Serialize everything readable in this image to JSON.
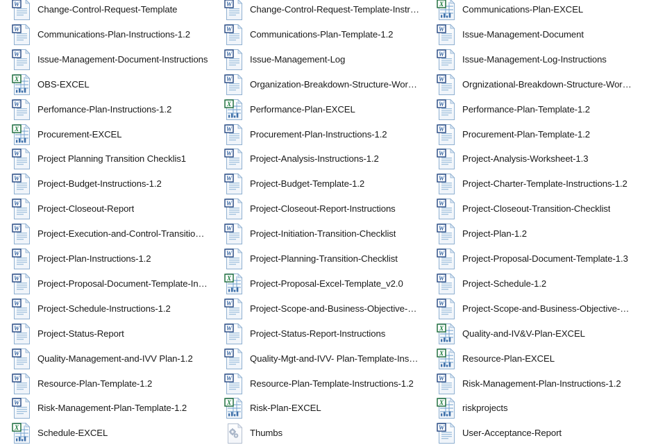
{
  "window": {
    "view_mode": "medium-icons-list",
    "columns": 3,
    "rows": 18,
    "background_color": "#ffffff",
    "text_color": "#1a1a1a"
  },
  "icon_types": {
    "word": {
      "name": "word-document-icon",
      "label": "W",
      "accent_color": "#2a5699",
      "page_color": "#ffffff",
      "border_color": "#9bb7d4"
    },
    "excel": {
      "name": "excel-spreadsheet-icon",
      "label": "X",
      "accent_color": "#1e7145",
      "page_color": "#ffffff",
      "border_color": "#9bb7d4"
    },
    "generic": {
      "name": "generic-system-file-icon",
      "accent_color": "#a8b5c6",
      "page_color": "#fbfbfd",
      "border_color": "#b9c4d2"
    }
  },
  "files": [
    {
      "name": "Change-Control-Request-Template",
      "type": "word",
      "column": 0,
      "row": 0
    },
    {
      "name": "Change-Control-Request-Template-Instructions",
      "type": "word",
      "column": 1,
      "row": 0
    },
    {
      "name": "Communications-Plan-EXCEL",
      "type": "excel",
      "column": 2,
      "row": 0
    },
    {
      "name": "Communications-Plan-Instructions-1.2",
      "type": "word",
      "column": 0,
      "row": 1
    },
    {
      "name": "Communications-Plan-Template-1.2",
      "type": "word",
      "column": 1,
      "row": 1
    },
    {
      "name": "Issue-Management-Document",
      "type": "word",
      "column": 2,
      "row": 1
    },
    {
      "name": "Issue-Management-Document-Instructions",
      "type": "word",
      "column": 0,
      "row": 2
    },
    {
      "name": "Issue-Management-Log",
      "type": "word",
      "column": 1,
      "row": 2
    },
    {
      "name": "Issue-Management-Log-Instructions",
      "type": "word",
      "column": 2,
      "row": 2
    },
    {
      "name": "OBS-EXCEL",
      "type": "excel",
      "column": 0,
      "row": 3
    },
    {
      "name": "Organization-Breakdown-Structure-Worksheet...",
      "type": "word",
      "column": 1,
      "row": 3
    },
    {
      "name": "Orgnizational-Breakdown-Structure-Workshee...",
      "type": "word",
      "column": 2,
      "row": 3
    },
    {
      "name": "Perfomance-Plan-Instructions-1.2",
      "type": "word",
      "column": 0,
      "row": 4
    },
    {
      "name": "Performance-Plan-EXCEL",
      "type": "excel",
      "column": 1,
      "row": 4
    },
    {
      "name": "Performance-Plan-Template-1.2",
      "type": "word",
      "column": 2,
      "row": 4
    },
    {
      "name": "Procurement-EXCEL",
      "type": "excel",
      "column": 0,
      "row": 5
    },
    {
      "name": "Procurement-Plan-Instructions-1.2",
      "type": "word",
      "column": 1,
      "row": 5
    },
    {
      "name": "Procurement-Plan-Template-1.2",
      "type": "word",
      "column": 2,
      "row": 5
    },
    {
      "name": "Project Planning Transition Checklis1",
      "type": "word",
      "column": 0,
      "row": 6
    },
    {
      "name": "Project-Analysis-Instructions-1.2",
      "type": "word",
      "column": 1,
      "row": 6
    },
    {
      "name": "Project-Analysis-Worksheet-1.3",
      "type": "word",
      "column": 2,
      "row": 6
    },
    {
      "name": "Project-Budget-Instructions-1.2",
      "type": "word",
      "column": 0,
      "row": 7
    },
    {
      "name": "Project-Budget-Template-1.2",
      "type": "word",
      "column": 1,
      "row": 7
    },
    {
      "name": "Project-Charter-Template-Instructions-1.2",
      "type": "word",
      "column": 2,
      "row": 7
    },
    {
      "name": "Project-Closeout-Report",
      "type": "word",
      "column": 0,
      "row": 8
    },
    {
      "name": "Project-Closeout-Report-Instructions",
      "type": "word",
      "column": 1,
      "row": 8
    },
    {
      "name": "Project-Closeout-Transition-Checklist",
      "type": "word",
      "column": 2,
      "row": 8
    },
    {
      "name": "Project-Execution-and-Control-Transition-Che...",
      "type": "word",
      "column": 0,
      "row": 9
    },
    {
      "name": "Project-Initiation-Transition-Checklist",
      "type": "word",
      "column": 1,
      "row": 9
    },
    {
      "name": "Project-Plan-1.2",
      "type": "word",
      "column": 2,
      "row": 9
    },
    {
      "name": "Project-Plan-Instructions-1.2",
      "type": "word",
      "column": 0,
      "row": 10
    },
    {
      "name": "Project-Planning-Transition-Checklist",
      "type": "word",
      "column": 1,
      "row": 10
    },
    {
      "name": "Project-Proposal-Document-Template-1.3",
      "type": "word",
      "column": 2,
      "row": 10
    },
    {
      "name": "Project-Proposal-Document-Template-Instruc...",
      "type": "word",
      "column": 0,
      "row": 11
    },
    {
      "name": "Project-Proposal-Excel-Template_v2.0",
      "type": "excel",
      "column": 1,
      "row": 11
    },
    {
      "name": "Project-Schedule-1.2",
      "type": "word",
      "column": 2,
      "row": 11
    },
    {
      "name": "Project-Schedule-Instructions-1.2",
      "type": "word",
      "column": 0,
      "row": 12
    },
    {
      "name": "Project-Scope-and-Business-Objective-Works...",
      "type": "word",
      "column": 1,
      "row": 12
    },
    {
      "name": "Project-Scope-and-Business-Objective-Works...",
      "type": "word",
      "column": 2,
      "row": 12
    },
    {
      "name": "Project-Status-Report",
      "type": "word",
      "column": 0,
      "row": 13
    },
    {
      "name": "Project-Status-Report-Instructions",
      "type": "word",
      "column": 1,
      "row": 13
    },
    {
      "name": "Quality-and-IV&V-Plan-EXCEL",
      "type": "excel",
      "column": 2,
      "row": 13
    },
    {
      "name": "Quality-Management-and-IVV Plan-1.2",
      "type": "word",
      "column": 0,
      "row": 14
    },
    {
      "name": "Quality-Mgt-and-IVV- Plan-Template-Instructi...",
      "type": "word",
      "column": 1,
      "row": 14
    },
    {
      "name": "Resource-Plan-EXCEL",
      "type": "excel",
      "column": 2,
      "row": 14
    },
    {
      "name": "Resource-Plan-Template-1.2",
      "type": "word",
      "column": 0,
      "row": 15
    },
    {
      "name": "Resource-Plan-Template-Instructions-1.2",
      "type": "word",
      "column": 1,
      "row": 15
    },
    {
      "name": "Risk-Management-Plan-Instructions-1.2",
      "type": "word",
      "column": 2,
      "row": 15
    },
    {
      "name": "Risk-Management-Plan-Template-1.2",
      "type": "word",
      "column": 0,
      "row": 16
    },
    {
      "name": "Risk-Plan-EXCEL",
      "type": "excel",
      "column": 1,
      "row": 16
    },
    {
      "name": "riskprojects",
      "type": "excel",
      "column": 2,
      "row": 16
    },
    {
      "name": "Schedule-EXCEL",
      "type": "excel",
      "column": 0,
      "row": 17
    },
    {
      "name": "Thumbs",
      "type": "generic",
      "column": 1,
      "row": 17
    },
    {
      "name": "User-Acceptance-Report",
      "type": "word",
      "column": 2,
      "row": 17
    }
  ]
}
